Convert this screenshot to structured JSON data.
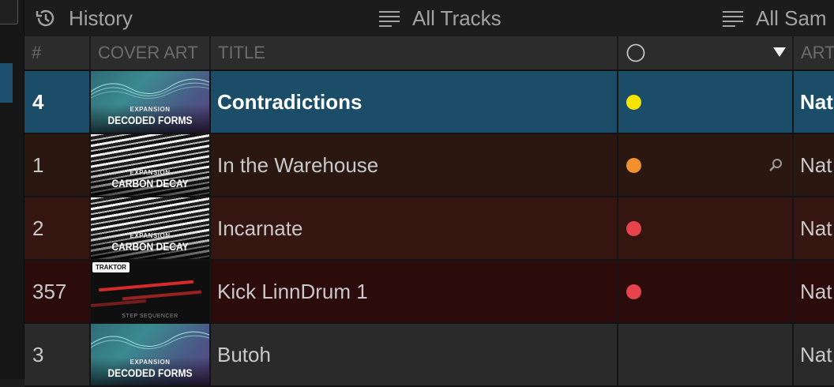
{
  "topbar": {
    "items": [
      {
        "label": "History",
        "icon": "history-icon"
      },
      {
        "label": "All Tracks",
        "icon": "list-icon"
      },
      {
        "label": "All Sam",
        "icon": "list-icon"
      }
    ]
  },
  "table": {
    "columns": {
      "num": "#",
      "cover": "COVER ART",
      "title": "TITLE",
      "artist": "ART"
    },
    "rows": [
      {
        "num": "4",
        "title": "Contradictions",
        "color": "#f5e400",
        "artist": "Nat",
        "cover": "decoded",
        "cover_small": "EXPANSION",
        "cover_big": "DECODED FORMS",
        "selected": true
      },
      {
        "num": "1",
        "title": "In  the Warehouse",
        "color": "#f0902e",
        "artist": "Nat",
        "cover": "carbon",
        "cover_small": "EXPANSION",
        "cover_big": "CARBON DECAY",
        "has_search": true
      },
      {
        "num": "2",
        "title": "Incarnate",
        "color": "#e6434c",
        "artist": "Nat",
        "cover": "carbon",
        "cover_small": "EXPANSION",
        "cover_big": "CARBON DECAY"
      },
      {
        "num": "357",
        "title": "Kick LinnDrum 1",
        "color": "#e6434c",
        "artist": "Nat",
        "cover": "traktor",
        "cover_badge": "TRAKTOR",
        "cover_sub": "STEP SEQUENCER"
      },
      {
        "num": "3",
        "title": "Butoh",
        "color": "",
        "artist": "Nat",
        "cover": "decoded",
        "cover_small": "EXPANSION",
        "cover_big": "DECODED FORMS"
      }
    ],
    "row_backgrounds": [
      "#1b4d68",
      "#2a1810",
      "#34150f",
      "#2c0c0b",
      "#2a2a2a"
    ]
  }
}
